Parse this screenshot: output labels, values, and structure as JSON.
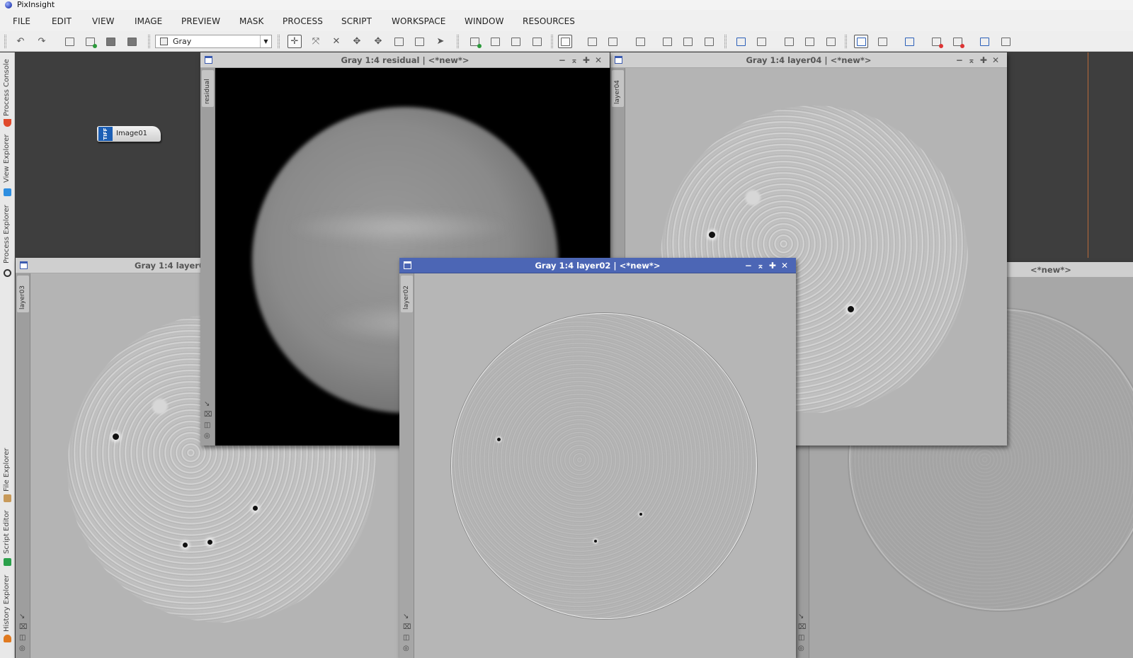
{
  "app": {
    "title": "PixInsight"
  },
  "menu": [
    "FILE",
    "EDIT",
    "VIEW",
    "IMAGE",
    "PREVIEW",
    "MASK",
    "PROCESS",
    "SCRIPT",
    "WORKSPACE",
    "WINDOW",
    "RESOURCES"
  ],
  "toolbar": {
    "image_selector": "Gray"
  },
  "side_tabs": {
    "process_console": "Process Console",
    "view_explorer": "View Explorer",
    "process_explorer": "Process Explorer",
    "file_explorer": "File Explorer",
    "script_editor": "Script Editor",
    "history_explorer": "History Explorer"
  },
  "desktop_icon": {
    "badge": "TIFF",
    "label": "Image01"
  },
  "windows": {
    "residual": {
      "title": "Gray 1:4 residual | <*new*>",
      "view_id": "residual"
    },
    "layer04": {
      "title": "Gray 1:4 layer04 | <*new*>",
      "view_id": "layer04"
    },
    "layer03": {
      "title": "Gray 1:4 layer0",
      "view_id": "layer03"
    },
    "layer02": {
      "title": "Gray 1:4 layer02 | <*new*>",
      "view_id": "layer02"
    },
    "layer01": {
      "title": "<*new*>"
    }
  },
  "colors": {
    "active_titlebar": "#4c66b5",
    "workspace": "#3e3e3e"
  }
}
